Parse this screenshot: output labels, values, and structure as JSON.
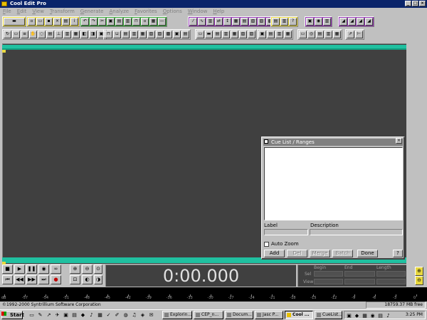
{
  "window": {
    "title": "Cool Edit Pro"
  },
  "menu": [
    "File",
    "Edit",
    "View",
    "Transform",
    "Generate",
    "Analyze",
    "Favorites",
    "Options",
    "Window",
    "Help"
  ],
  "cue_dialog": {
    "title": "Cue List / Ranges",
    "label_header": "Label",
    "description_header": "Description",
    "auto_zoom": "Auto Zoom",
    "buttons": {
      "add": "Add",
      "del": "Del",
      "merge": "Merge",
      "batch": "Batch",
      "done": "Done",
      "help": "?"
    }
  },
  "time_display": "0:00.000",
  "selection": {
    "headers": {
      "begin": "Begin",
      "end": "End",
      "length": "Length"
    },
    "rows": {
      "sel": "Sel",
      "view": "View"
    }
  },
  "meter": {
    "labels": [
      "dB",
      "-57",
      "-54",
      "-51",
      "-48",
      "-45",
      "-42",
      "-39",
      "-36",
      "-33",
      "-30",
      "-27",
      "-24",
      "-21",
      "-18",
      "-15",
      "-12",
      "-9",
      "-6",
      "-3",
      "0"
    ]
  },
  "status": {
    "copyright": "©1992-2000 Syntrillium Software Corporation",
    "free_space": "18759.37 MB free"
  },
  "taskbar": {
    "start": "Start",
    "tasks": [
      "Explorin...",
      "CEP_n...",
      "Docum...",
      "Jasc P...",
      "Cool ...",
      "CueList..."
    ],
    "clock": "3:25 PM"
  },
  "colors": {
    "wave_bg": "#404040",
    "wave_strip": "#20c0a0",
    "titlebar": "#0a246a"
  }
}
